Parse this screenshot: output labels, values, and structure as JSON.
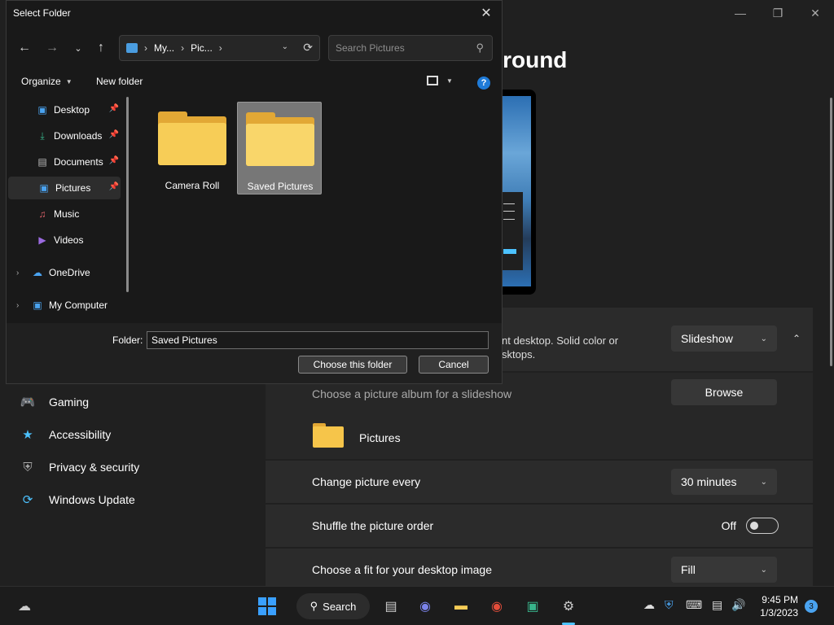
{
  "settings": {
    "page_title": "ground",
    "bg_desc_line1": "nt desktop. Solid color or",
    "bg_desc_line2": "sktops.",
    "bg_type": "Slideshow",
    "album_label": "Choose a picture album for a slideshow",
    "browse": "Browse",
    "album_name": "Pictures",
    "change_every_label": "Change picture every",
    "change_every_value": "30 minutes",
    "shuffle_label": "Shuffle the picture order",
    "shuffle_state": "Off",
    "fit_label": "Choose a fit for your desktop image",
    "fit_value": "Fill",
    "nav": [
      {
        "label": "Gaming",
        "icon": "gamepad-icon"
      },
      {
        "label": "Accessibility",
        "icon": "accessibility-icon"
      },
      {
        "label": "Privacy & security",
        "icon": "shield-icon"
      },
      {
        "label": "Windows Update",
        "icon": "update-icon"
      }
    ]
  },
  "dialog": {
    "title": "Select Folder",
    "breadcrumb": [
      "My...",
      "Pic..."
    ],
    "search_placeholder": "Search Pictures",
    "organize": "Organize",
    "new_folder": "New folder",
    "tree": [
      {
        "label": "Desktop",
        "pinned": true
      },
      {
        "label": "Downloads",
        "pinned": true
      },
      {
        "label": "Documents",
        "pinned": true
      },
      {
        "label": "Pictures",
        "pinned": true,
        "selected": true
      },
      {
        "label": "Music"
      },
      {
        "label": "Videos"
      },
      {
        "label": "OneDrive"
      },
      {
        "label": "My Computer"
      }
    ],
    "folders": [
      {
        "name": "Camera Roll"
      },
      {
        "name": "Saved Pictures",
        "selected": true
      }
    ],
    "folder_label": "Folder:",
    "folder_value": "Saved Pictures",
    "choose_btn": "Choose this folder",
    "cancel_btn": "Cancel"
  },
  "taskbar": {
    "search": "Search",
    "time": "9:45 PM",
    "date": "1/3/2023",
    "notifications": "3"
  },
  "colors": {
    "accent": "#4cc2ff",
    "folder": "#f7cd57"
  }
}
